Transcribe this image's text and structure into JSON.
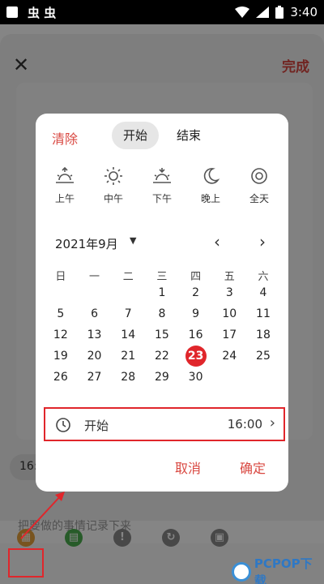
{
  "status_bar": {
    "app_glyphs": "虫 虫",
    "time": "3:40"
  },
  "page": {
    "done_label": "完成",
    "time_chip": "16:",
    "input_placeholder": "把要做的事情记录下来"
  },
  "dialog": {
    "clear_label": "清除",
    "tabs": {
      "start": "开始",
      "end": "结束"
    },
    "presets": [
      {
        "icon": "sunrise-icon",
        "label": "上午"
      },
      {
        "icon": "sun-icon",
        "label": "中午"
      },
      {
        "icon": "sunset-icon",
        "label": "下午"
      },
      {
        "icon": "moon-icon",
        "label": "晚上"
      },
      {
        "icon": "all-day-icon",
        "label": "全天"
      }
    ],
    "month_label": "2021年9月",
    "weekdays": [
      "日",
      "一",
      "二",
      "三",
      "四",
      "五",
      "六"
    ],
    "weeks": [
      [
        "",
        "",
        "",
        "1",
        "2",
        "3",
        "4"
      ],
      [
        "5",
        "6",
        "7",
        "8",
        "9",
        "10",
        "11"
      ],
      [
        "12",
        "13",
        "14",
        "15",
        "16",
        "17",
        "18"
      ],
      [
        "19",
        "20",
        "21",
        "22",
        "23",
        "24",
        "25"
      ],
      [
        "26",
        "27",
        "28",
        "29",
        "30",
        "",
        ""
      ]
    ],
    "selected_day": "23",
    "start_row": {
      "label": "开始",
      "time": "16:00"
    },
    "cancel_label": "取消",
    "confirm_label": "确定"
  },
  "watermark": {
    "text": "PCPOP下载"
  },
  "colors": {
    "accent": "#d94841",
    "selected": "#e0262b",
    "annotation": "#e0262b"
  }
}
